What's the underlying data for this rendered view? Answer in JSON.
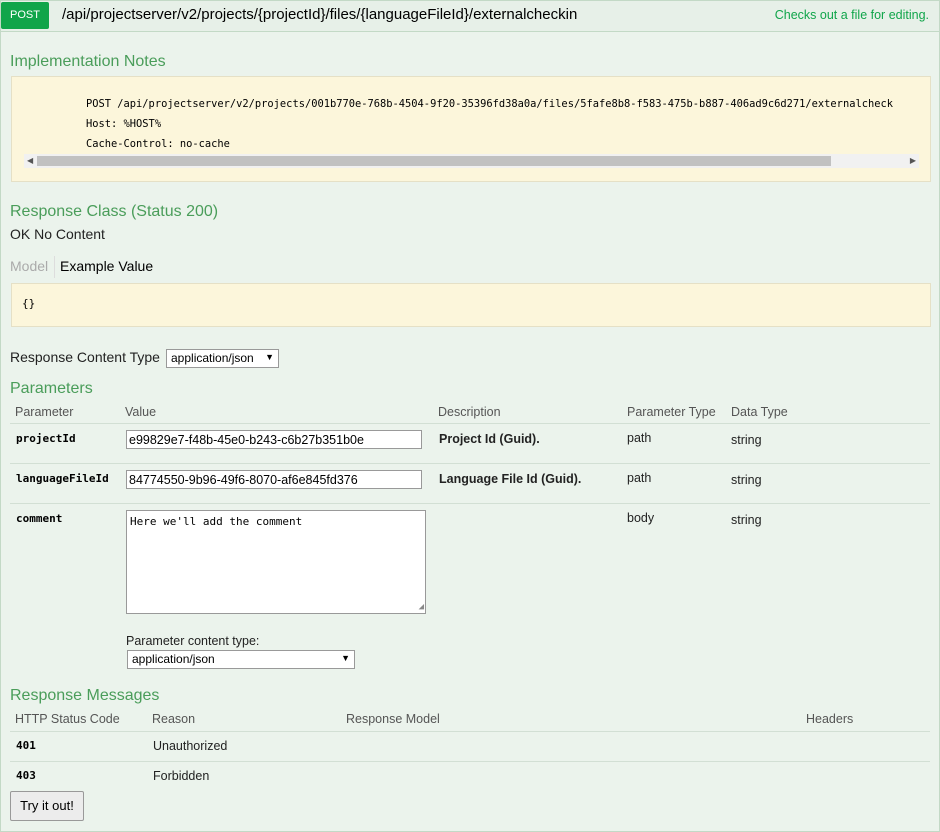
{
  "operation": {
    "method": "POST",
    "path": "/api/projectserver/v2/projects/{projectId}/files/{languageFileId}/externalcheckin",
    "summary": "Checks out a file for editing."
  },
  "implementation_notes": {
    "heading": "Implementation Notes",
    "code_lines": [
      "POST /api/projectserver/v2/projects/001b770e-768b-4504-9f20-35396fd38a0a/files/5fafe8b8-f583-475b-b887-406ad9c6d271/externalcheck",
      "Host: %HOST%",
      "Cache-Control: no-cache"
    ]
  },
  "response_class": {
    "heading": "Response Class (Status 200)",
    "text": "OK No Content",
    "model_tab": "Model",
    "example_tab": "Example Value",
    "example_value": "{}"
  },
  "response_content_type": {
    "label": "Response Content Type",
    "value": "application/json"
  },
  "parameters": {
    "heading": "Parameters",
    "columns": [
      "Parameter",
      "Value",
      "Description",
      "Parameter Type",
      "Data Type"
    ],
    "rows": [
      {
        "name": "projectId",
        "value": "e99829e7-f48b-45e0-b243-c6b27b351b0e",
        "description": "Project Id (Guid).",
        "param_type": "path",
        "data_type": "string"
      },
      {
        "name": "languageFileId",
        "value": "84774550-9b96-49f6-8070-af6e845fd376",
        "description": "Language File Id (Guid).",
        "param_type": "path",
        "data_type": "string"
      },
      {
        "name": "comment",
        "value": "Here we'll add the comment",
        "description": "",
        "param_type": "body",
        "data_type": "string"
      }
    ],
    "content_type_label": "Parameter content type:",
    "content_type_value": "application/json"
  },
  "response_messages": {
    "heading": "Response Messages",
    "columns": [
      "HTTP Status Code",
      "Reason",
      "Response Model",
      "Headers"
    ],
    "rows": [
      {
        "code": "401",
        "reason": "Unauthorized"
      },
      {
        "code": "403",
        "reason": "Forbidden"
      }
    ]
  },
  "try_button": "Try it out!",
  "colors": {
    "method": "#10a54a",
    "heading": "#4a9d5a",
    "code_bg": "#fcf6db",
    "panel_bg": "#ebf3ec"
  }
}
